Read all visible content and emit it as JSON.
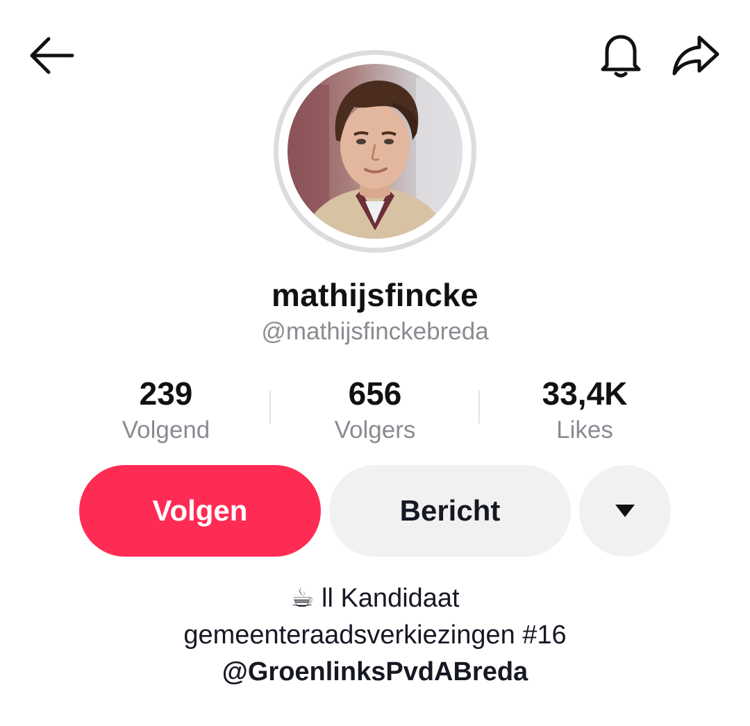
{
  "header": {
    "back_icon": "arrow-left-icon",
    "notification_icon": "bell-icon",
    "share_icon": "share-arrow-icon"
  },
  "profile": {
    "avatar_icon": "profile-photo",
    "display_name": "mathijsfincke",
    "username": "@mathijsfinckebreda"
  },
  "stats": [
    {
      "value": "239",
      "label": "Volgend"
    },
    {
      "value": "656",
      "label": "Volgers"
    },
    {
      "value": "33,4K",
      "label": "Likes"
    }
  ],
  "actions": {
    "follow_label": "Volgen",
    "message_label": "Bericht",
    "more_icon": "triangle-down-icon"
  },
  "bio": {
    "emoji": "☕",
    "line1_text": " ll Kandidaat",
    "line2": "gemeenteraadsverkiezingen #16",
    "mention": "@GroenlinksPvdABreda"
  },
  "colors": {
    "accent": "#fe2c55",
    "secondary_button": "#f1f1f2",
    "muted_text": "#8a8b91",
    "avatar_ring": "#dcdcdc"
  }
}
